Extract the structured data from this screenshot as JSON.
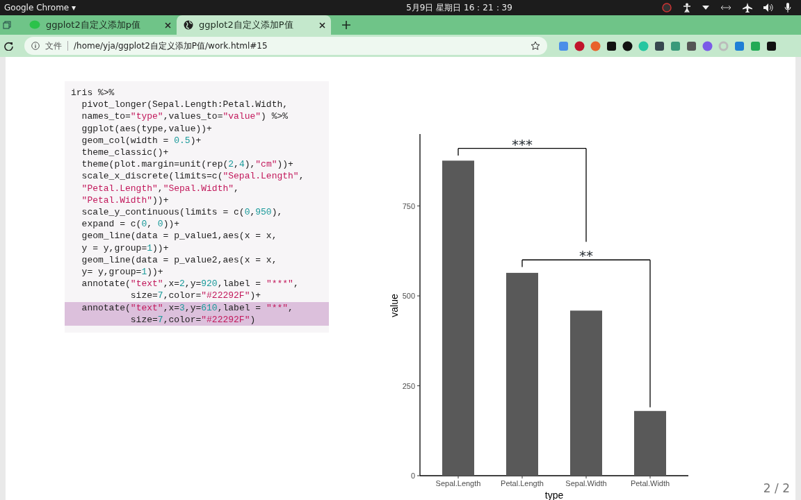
{
  "system_bar": {
    "app_menu": "Google Chrome ▾",
    "clock": "5月9日 星期日  16：21：39"
  },
  "tabs": [
    {
      "title": "ggplot2自定义添加p值",
      "selected": false
    },
    {
      "title": "ggplot2自定义添加P值",
      "selected": true
    }
  ],
  "address_bar": {
    "scheme_label": "文件",
    "url": "/home/yja/ggplot2自定义添加P值/work.html#15"
  },
  "code": {
    "lines": [
      {
        "highlighted": false,
        "tokens": [
          {
            "kind": "plain",
            "text": "iris %>%"
          }
        ]
      },
      {
        "highlighted": false,
        "tokens": [
          {
            "kind": "plain",
            "text": "  pivot_longer(Sepal.Length:Petal.Width,"
          }
        ]
      },
      {
        "highlighted": false,
        "tokens": [
          {
            "kind": "plain",
            "text": "  names_to="
          },
          {
            "kind": "string",
            "text": "\"type\""
          },
          {
            "kind": "plain",
            "text": ",values_to="
          },
          {
            "kind": "string",
            "text": "\"value\""
          },
          {
            "kind": "plain",
            "text": ") %>%"
          }
        ]
      },
      {
        "highlighted": false,
        "tokens": [
          {
            "kind": "plain",
            "text": "  ggplot(aes(type,value))+"
          }
        ]
      },
      {
        "highlighted": false,
        "tokens": [
          {
            "kind": "plain",
            "text": "  geom_col(width = "
          },
          {
            "kind": "number",
            "text": "0.5"
          },
          {
            "kind": "plain",
            "text": ")+"
          }
        ]
      },
      {
        "highlighted": false,
        "tokens": [
          {
            "kind": "plain",
            "text": "  theme_classic()+"
          }
        ]
      },
      {
        "highlighted": false,
        "tokens": [
          {
            "kind": "plain",
            "text": "  theme(plot.margin=unit(rep("
          },
          {
            "kind": "number",
            "text": "2"
          },
          {
            "kind": "plain",
            "text": ","
          },
          {
            "kind": "number",
            "text": "4"
          },
          {
            "kind": "plain",
            "text": "),"
          },
          {
            "kind": "string",
            "text": "\"cm\""
          },
          {
            "kind": "plain",
            "text": "))+"
          }
        ]
      },
      {
        "highlighted": false,
        "tokens": [
          {
            "kind": "plain",
            "text": "  scale_x_discrete(limits=c("
          },
          {
            "kind": "string",
            "text": "\"Sepal.Length\""
          },
          {
            "kind": "plain",
            "text": ","
          }
        ]
      },
      {
        "highlighted": false,
        "tokens": [
          {
            "kind": "string",
            "text": "  \"Petal.Length\""
          },
          {
            "kind": "plain",
            "text": ","
          },
          {
            "kind": "string",
            "text": "\"Sepal.Width\""
          },
          {
            "kind": "plain",
            "text": ","
          }
        ]
      },
      {
        "highlighted": false,
        "tokens": [
          {
            "kind": "string",
            "text": "  \"Petal.Width\""
          },
          {
            "kind": "plain",
            "text": "))+"
          }
        ]
      },
      {
        "highlighted": false,
        "tokens": [
          {
            "kind": "plain",
            "text": "  scale_y_continuous(limits = c("
          },
          {
            "kind": "number",
            "text": "0"
          },
          {
            "kind": "plain",
            "text": ","
          },
          {
            "kind": "number",
            "text": "950"
          },
          {
            "kind": "plain",
            "text": "),"
          }
        ]
      },
      {
        "highlighted": false,
        "tokens": [
          {
            "kind": "plain",
            "text": "  expand = c("
          },
          {
            "kind": "number",
            "text": "0"
          },
          {
            "kind": "plain",
            "text": ", "
          },
          {
            "kind": "number",
            "text": "0"
          },
          {
            "kind": "plain",
            "text": "))+"
          }
        ]
      },
      {
        "highlighted": false,
        "tokens": [
          {
            "kind": "plain",
            "text": "  geom_line(data = p_value1,aes(x = x,"
          }
        ]
      },
      {
        "highlighted": false,
        "tokens": [
          {
            "kind": "plain",
            "text": "  y = y,group="
          },
          {
            "kind": "number",
            "text": "1"
          },
          {
            "kind": "plain",
            "text": "))+"
          }
        ]
      },
      {
        "highlighted": false,
        "tokens": [
          {
            "kind": "plain",
            "text": "  geom_line(data = p_value2,aes(x = x,"
          }
        ]
      },
      {
        "highlighted": false,
        "tokens": [
          {
            "kind": "plain",
            "text": "  y= y,group="
          },
          {
            "kind": "number",
            "text": "1"
          },
          {
            "kind": "plain",
            "text": "))+"
          }
        ]
      },
      {
        "highlighted": false,
        "tokens": [
          {
            "kind": "plain",
            "text": "  annotate("
          },
          {
            "kind": "string",
            "text": "\"text\""
          },
          {
            "kind": "plain",
            "text": ",x="
          },
          {
            "kind": "number",
            "text": "2"
          },
          {
            "kind": "plain",
            "text": ",y="
          },
          {
            "kind": "number",
            "text": "920"
          },
          {
            "kind": "plain",
            "text": ",label = "
          },
          {
            "kind": "string",
            "text": "\"***\""
          },
          {
            "kind": "plain",
            "text": ","
          }
        ]
      },
      {
        "highlighted": false,
        "tokens": [
          {
            "kind": "plain",
            "text": "           size="
          },
          {
            "kind": "number",
            "text": "7"
          },
          {
            "kind": "plain",
            "text": ",color="
          },
          {
            "kind": "string",
            "text": "\"#22292F\""
          },
          {
            "kind": "plain",
            "text": ")+"
          }
        ]
      },
      {
        "highlighted": true,
        "tokens": [
          {
            "kind": "plain",
            "text": "  annotate("
          },
          {
            "kind": "string",
            "text": "\"text\""
          },
          {
            "kind": "plain",
            "text": ",x="
          },
          {
            "kind": "number",
            "text": "3"
          },
          {
            "kind": "plain",
            "text": ",y="
          },
          {
            "kind": "number",
            "text": "610"
          },
          {
            "kind": "plain",
            "text": ",label = "
          },
          {
            "kind": "string",
            "text": "\"**\""
          },
          {
            "kind": "plain",
            "text": ","
          }
        ]
      },
      {
        "highlighted": true,
        "tokens": [
          {
            "kind": "plain",
            "text": "           size="
          },
          {
            "kind": "number",
            "text": "7"
          },
          {
            "kind": "plain",
            "text": ",color="
          },
          {
            "kind": "string",
            "text": "\"#22292F\""
          },
          {
            "kind": "plain",
            "text": ")"
          }
        ]
      }
    ]
  },
  "chart_data": {
    "type": "bar",
    "xlabel": "type",
    "ylabel": "value",
    "categories": [
      "Sepal.Length",
      "Petal.Length",
      "Sepal.Width",
      "Petal.Width"
    ],
    "series": [
      {
        "color": "#595959",
        "values": [
          876,
          564,
          459,
          180
        ]
      }
    ],
    "ylim": [
      0,
      950
    ],
    "yticks": [
      0,
      250,
      500,
      750
    ],
    "annotations": [
      "***",
      "**"
    ]
  },
  "page_counter": "2 / 2"
}
